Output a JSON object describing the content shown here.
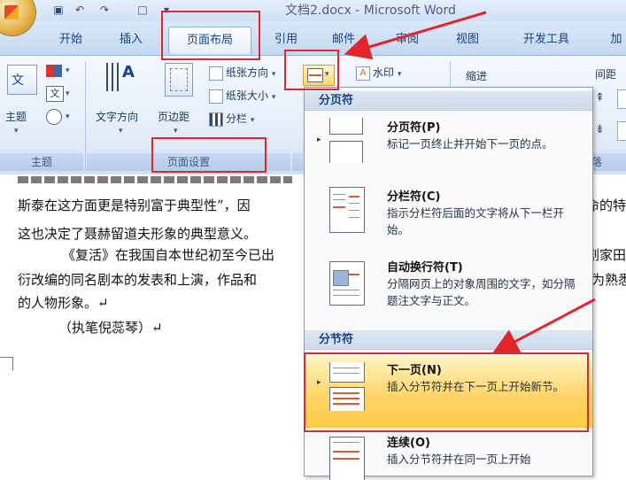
{
  "window": {
    "title": "文档2.docx - Microsoft Word"
  },
  "tabs": [
    "开始",
    "插入",
    "页面布局",
    "引用",
    "邮件",
    "审阅",
    "视图",
    "开发工具",
    "加"
  ],
  "ribbon": {
    "theme_group": {
      "label": "主题",
      "theme_button": "主题"
    },
    "page_setup": {
      "label": "页面设置",
      "text_direction": "文字方向",
      "margins": "页边距",
      "orientation": "纸张方向",
      "size": "纸张大小",
      "columns": "分栏"
    },
    "watermark": "水印",
    "indent_label": "缩进",
    "spacing_label": "间距",
    "right_partial": "落"
  },
  "document": {
    "lines": [
      "斯泰在这方面更是特别富于典型性”，因",
      "这也决定了聂赫留道夫形象的典型意义。",
      "《复活》在我国自本世纪初至今已出",
      "衍改编的同名剧本的发表和上演，作品和",
      "的人物形象。↵",
      "（执笔倪蕊琴）↵"
    ],
    "right_fragments": [
      "命的特",
      "剧家田汉",
      "为熟悉和"
    ]
  },
  "menu": {
    "section_page_breaks": "分页符",
    "section_section_breaks": "分节符",
    "items": [
      {
        "title": "分页符(P)",
        "desc": "标记一页终止并开始下一页的点。"
      },
      {
        "title": "分栏符(C)",
        "desc": "指示分栏符后面的文字将从下一栏开始。"
      },
      {
        "title": "自动换行符(T)",
        "desc": "分隔网页上的对象周围的文字，如分隔题注文字与正文。"
      },
      {
        "title": "下一页(N)",
        "desc": "插入分节符并在下一页上开始新节。"
      },
      {
        "title": "连续(O)",
        "desc": "插入分节符并在同一页上开始"
      }
    ]
  }
}
